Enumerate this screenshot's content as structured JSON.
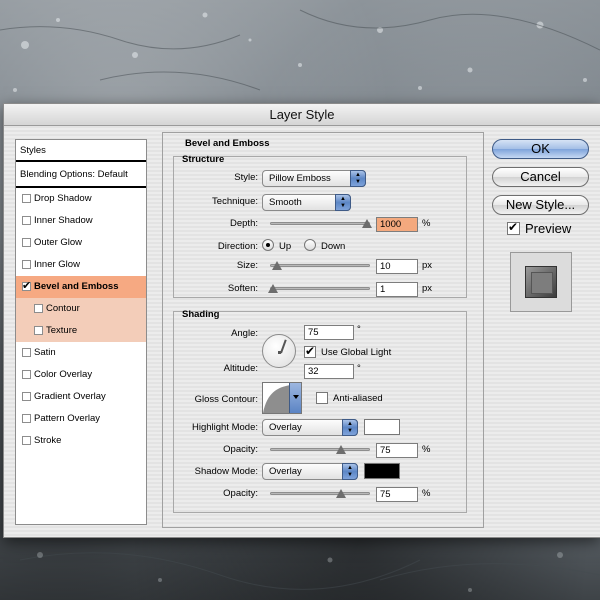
{
  "dialog": {
    "title": "Layer Style"
  },
  "sidebar": {
    "header": "Styles",
    "blending": "Blending Options: Default",
    "items": [
      {
        "label": "Drop Shadow",
        "checked": false
      },
      {
        "label": "Inner Shadow",
        "checked": false
      },
      {
        "label": "Outer Glow",
        "checked": false
      },
      {
        "label": "Inner Glow",
        "checked": false
      },
      {
        "label": "Bevel and Emboss",
        "checked": true,
        "selected": true
      },
      {
        "label": "Contour",
        "checked": false,
        "sub": true
      },
      {
        "label": "Texture",
        "checked": false,
        "sub": true
      },
      {
        "label": "Satin",
        "checked": false
      },
      {
        "label": "Color Overlay",
        "checked": false
      },
      {
        "label": "Gradient Overlay",
        "checked": false
      },
      {
        "label": "Pattern Overlay",
        "checked": false
      },
      {
        "label": "Stroke",
        "checked": false
      }
    ]
  },
  "panel": {
    "title": "Bevel and Emboss",
    "structure": {
      "title": "Structure",
      "style_label": "Style:",
      "style_value": "Pillow Emboss",
      "technique_label": "Technique:",
      "technique_value": "Smooth",
      "depth_label": "Depth:",
      "depth_value": "1000",
      "depth_unit": "%",
      "direction_label": "Direction:",
      "dir_up": "Up",
      "dir_down": "Down",
      "size_label": "Size:",
      "size_value": "10",
      "size_unit": "px",
      "soften_label": "Soften:",
      "soften_value": "1",
      "soften_unit": "px"
    },
    "shading": {
      "title": "Shading",
      "angle_label": "Angle:",
      "angle_value": "75",
      "degree": "°",
      "global_light": "Use Global Light",
      "altitude_label": "Altitude:",
      "altitude_value": "32",
      "gloss_label": "Gloss Contour:",
      "anti_aliased": "Anti-aliased",
      "highlight_label": "Highlight Mode:",
      "highlight_value": "Overlay",
      "highlight_color": "#ffffff",
      "opacity_label": "Opacity:",
      "highlight_opacity": "75",
      "shadow_label": "Shadow Mode:",
      "shadow_value": "Overlay",
      "shadow_color": "#000000",
      "shadow_opacity": "75",
      "percent": "%"
    }
  },
  "buttons": {
    "ok": "OK",
    "cancel": "Cancel",
    "new_style": "New Style...",
    "preview": "Preview"
  },
  "colors": {
    "selected_row": "#f6a982",
    "sub_row": "#f3cdb9",
    "depth_highlight": "#f4a97e",
    "accent_blue": "#7ea3db"
  }
}
